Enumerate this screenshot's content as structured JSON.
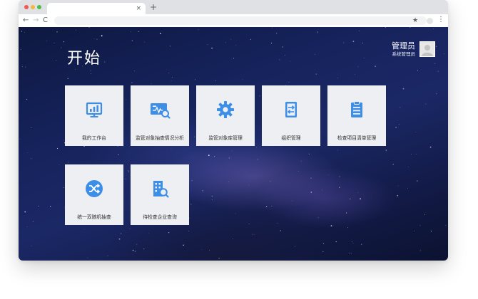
{
  "browser": {
    "tab_close": "×",
    "new_tab": "+",
    "back": "←",
    "forward": "→",
    "reload": "C",
    "star": "★",
    "menu": "⋮"
  },
  "page": {
    "title": "开始"
  },
  "user": {
    "name": "管理员",
    "role": "系统管理员"
  },
  "colors": {
    "icon_blue": "#3d8ee6",
    "tile_bg": "#eeeff2"
  },
  "tiles": [
    {
      "label": "我的工作台",
      "icon": "monitor-chart-icon"
    },
    {
      "label": "监管对象抽查情况分析",
      "icon": "pulse-card-search-icon"
    },
    {
      "label": "监管对象库管理",
      "icon": "gear-icon"
    },
    {
      "label": "组织管理",
      "icon": "swap-document-icon"
    },
    {
      "label": "检查项目清单管理",
      "icon": "clipboard-list-icon"
    },
    {
      "label": "统一双随机抽查",
      "icon": "shuffle-icon"
    },
    {
      "label": "待检查企业查询",
      "icon": "building-search-icon"
    }
  ]
}
